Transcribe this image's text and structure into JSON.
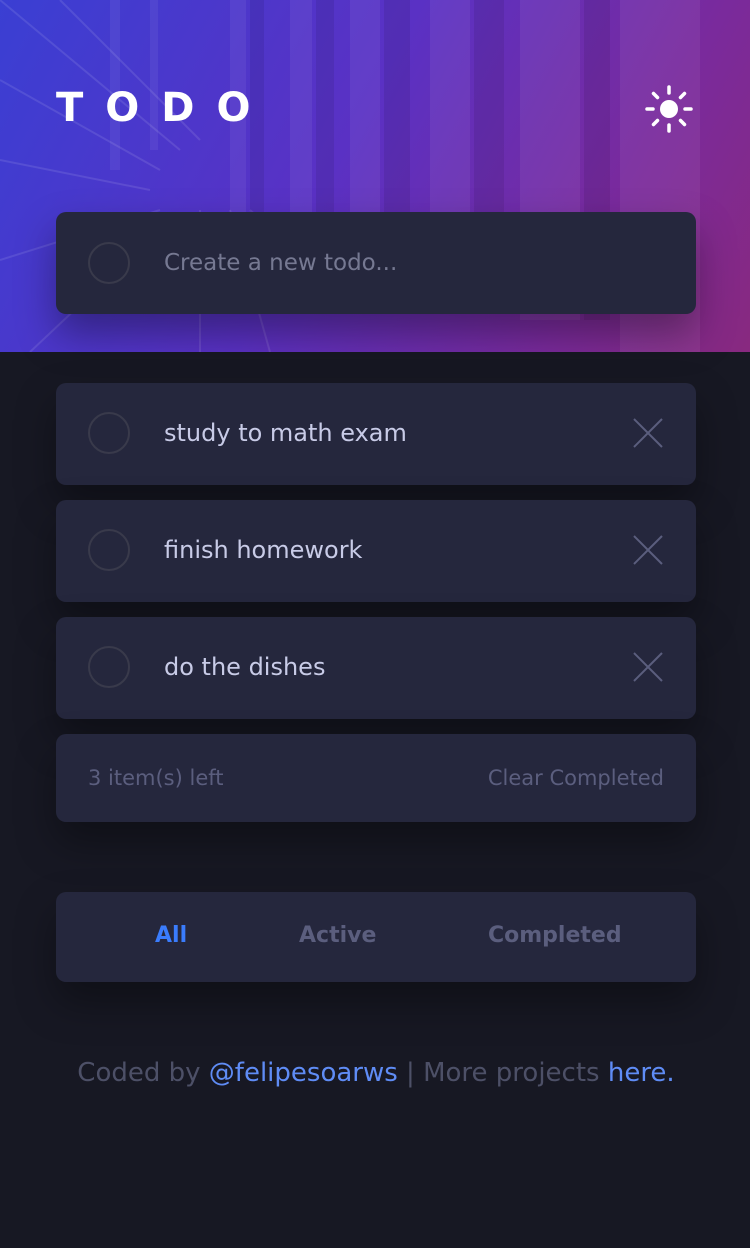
{
  "header": {
    "title": "TODO",
    "theme_icon": "sun-icon"
  },
  "new_todo": {
    "placeholder": "Create a new todo..."
  },
  "todos": [
    {
      "text": "study to math exam",
      "completed": false
    },
    {
      "text": "finish homework",
      "completed": false
    },
    {
      "text": "do the dishes",
      "completed": false
    }
  ],
  "status": {
    "items_left": "3 item(s) left",
    "clear_label": "Clear Completed"
  },
  "filters": {
    "all": "All",
    "active": "Active",
    "completed": "Completed",
    "selected": "All"
  },
  "footer": {
    "prefix": "Coded by ",
    "author": "@felipesoarws",
    "middle": " | More projects ",
    "link": "here."
  },
  "colors": {
    "accent": "#3a7cfd",
    "card": "#25273d",
    "background": "#171823",
    "gradient_start": "#3a3fd3",
    "gradient_end": "#88297f"
  }
}
